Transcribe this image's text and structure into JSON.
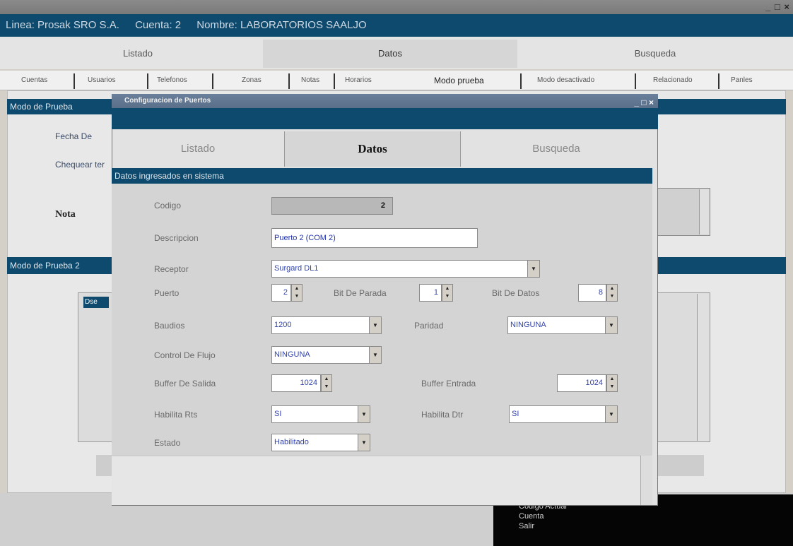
{
  "outer_window": {
    "title": "",
    "controls": "_ □ ×",
    "info": {
      "linea": "Linea: Prosak SRO S.A.",
      "cuenta": "Cuenta: 2",
      "nombre": "Nombre: LABORATORIOS SAALJO"
    },
    "main_tabs": [
      {
        "label": "Listado"
      },
      {
        "label": "Datos"
      },
      {
        "label": "Busqueda"
      }
    ],
    "sub_tabs": [
      {
        "label": "Cuentas"
      },
      {
        "label": "Usuarios"
      },
      {
        "label": "Telefonos"
      },
      {
        "label": "Zonas"
      },
      {
        "label": "Notas"
      },
      {
        "label": "Horarios"
      },
      {
        "label": "Modo prueba"
      },
      {
        "label": "Modo desactivado"
      },
      {
        "label": "Relacionado"
      },
      {
        "label": "Panles"
      }
    ],
    "section1_title": "Modo de Prueba",
    "fecha_label": "Fecha De",
    "chequear_label": "Chequear ter",
    "nota_label": "Nota",
    "section2_title": "Modo de Prueba 2",
    "list_item": "Dse",
    "status_lines": [
      "Codigo Actual",
      "Cuenta",
      "Salir"
    ]
  },
  "dialog": {
    "title": "Configuracion de Puertos",
    "controls": "_ □ ×",
    "tabs": [
      {
        "label": "Listado"
      },
      {
        "label": "Datos"
      },
      {
        "label": "Busqueda"
      }
    ],
    "section_title": "Datos ingresados en sistema",
    "fields": {
      "codigo": {
        "label": "Codigo",
        "value": "2"
      },
      "descripcion": {
        "label": "Descripcion",
        "value": "Puerto 2 (COM 2)"
      },
      "receptor": {
        "label": "Receptor",
        "value": "Surgard DL1"
      },
      "puerto": {
        "label": "Puerto",
        "value": "2"
      },
      "bit_parada": {
        "label": "Bit De Parada",
        "value": "1"
      },
      "bit_datos": {
        "label": "Bit De Datos",
        "value": "8"
      },
      "baudios": {
        "label": "Baudios",
        "value": "1200"
      },
      "paridad": {
        "label": "Paridad",
        "value": "NINGUNA"
      },
      "control_flujo": {
        "label": "Control De Flujo",
        "value": "NINGUNA"
      },
      "buffer_salida": {
        "label": "Buffer De Salida",
        "value": "1024"
      },
      "buffer_entrada": {
        "label": "Buffer Entrada",
        "value": "1024"
      },
      "habilita_rts": {
        "label": "Habilita Rts",
        "value": "SI"
      },
      "habilita_dtr": {
        "label": "Habilita Dtr",
        "value": "SI"
      },
      "estado": {
        "label": "Estado",
        "value": "Habilitado"
      }
    }
  },
  "colors": {
    "navy": "#0e4a6e",
    "face": "#d4d0c8"
  }
}
